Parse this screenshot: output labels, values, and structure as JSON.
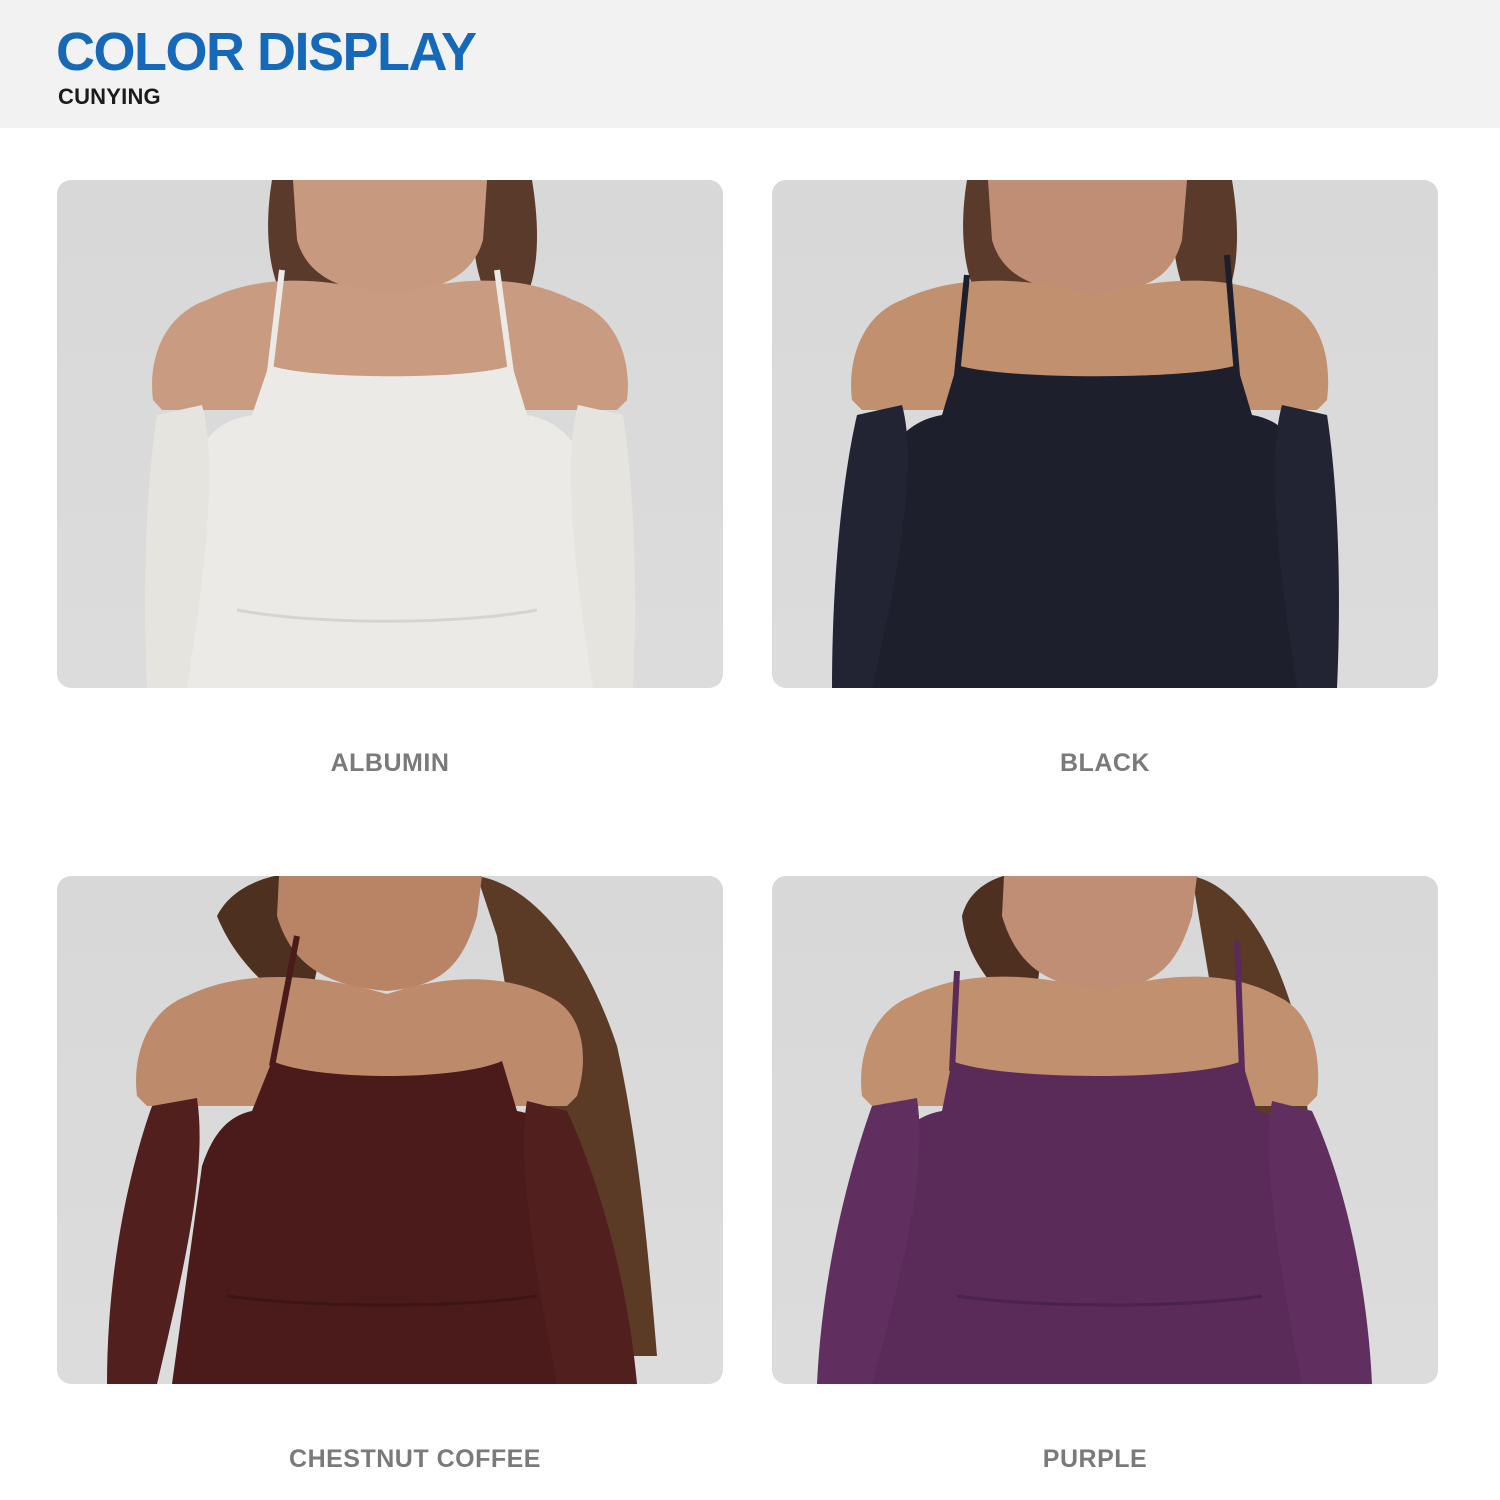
{
  "header": {
    "title": "COLOR DISPLAY",
    "subtitle": "CUNYING"
  },
  "colors": {
    "title_blue": "#1669b8",
    "albumin": "#eceae6",
    "black": "#1d1f2c",
    "chestnut_coffee": "#4a1b1a",
    "purple": "#5a2a58"
  },
  "swatches": [
    {
      "label": "ALBUMIN"
    },
    {
      "label": "BLACK"
    },
    {
      "label": "CHESTNUT COFFEE"
    },
    {
      "label": "PURPLE"
    }
  ]
}
